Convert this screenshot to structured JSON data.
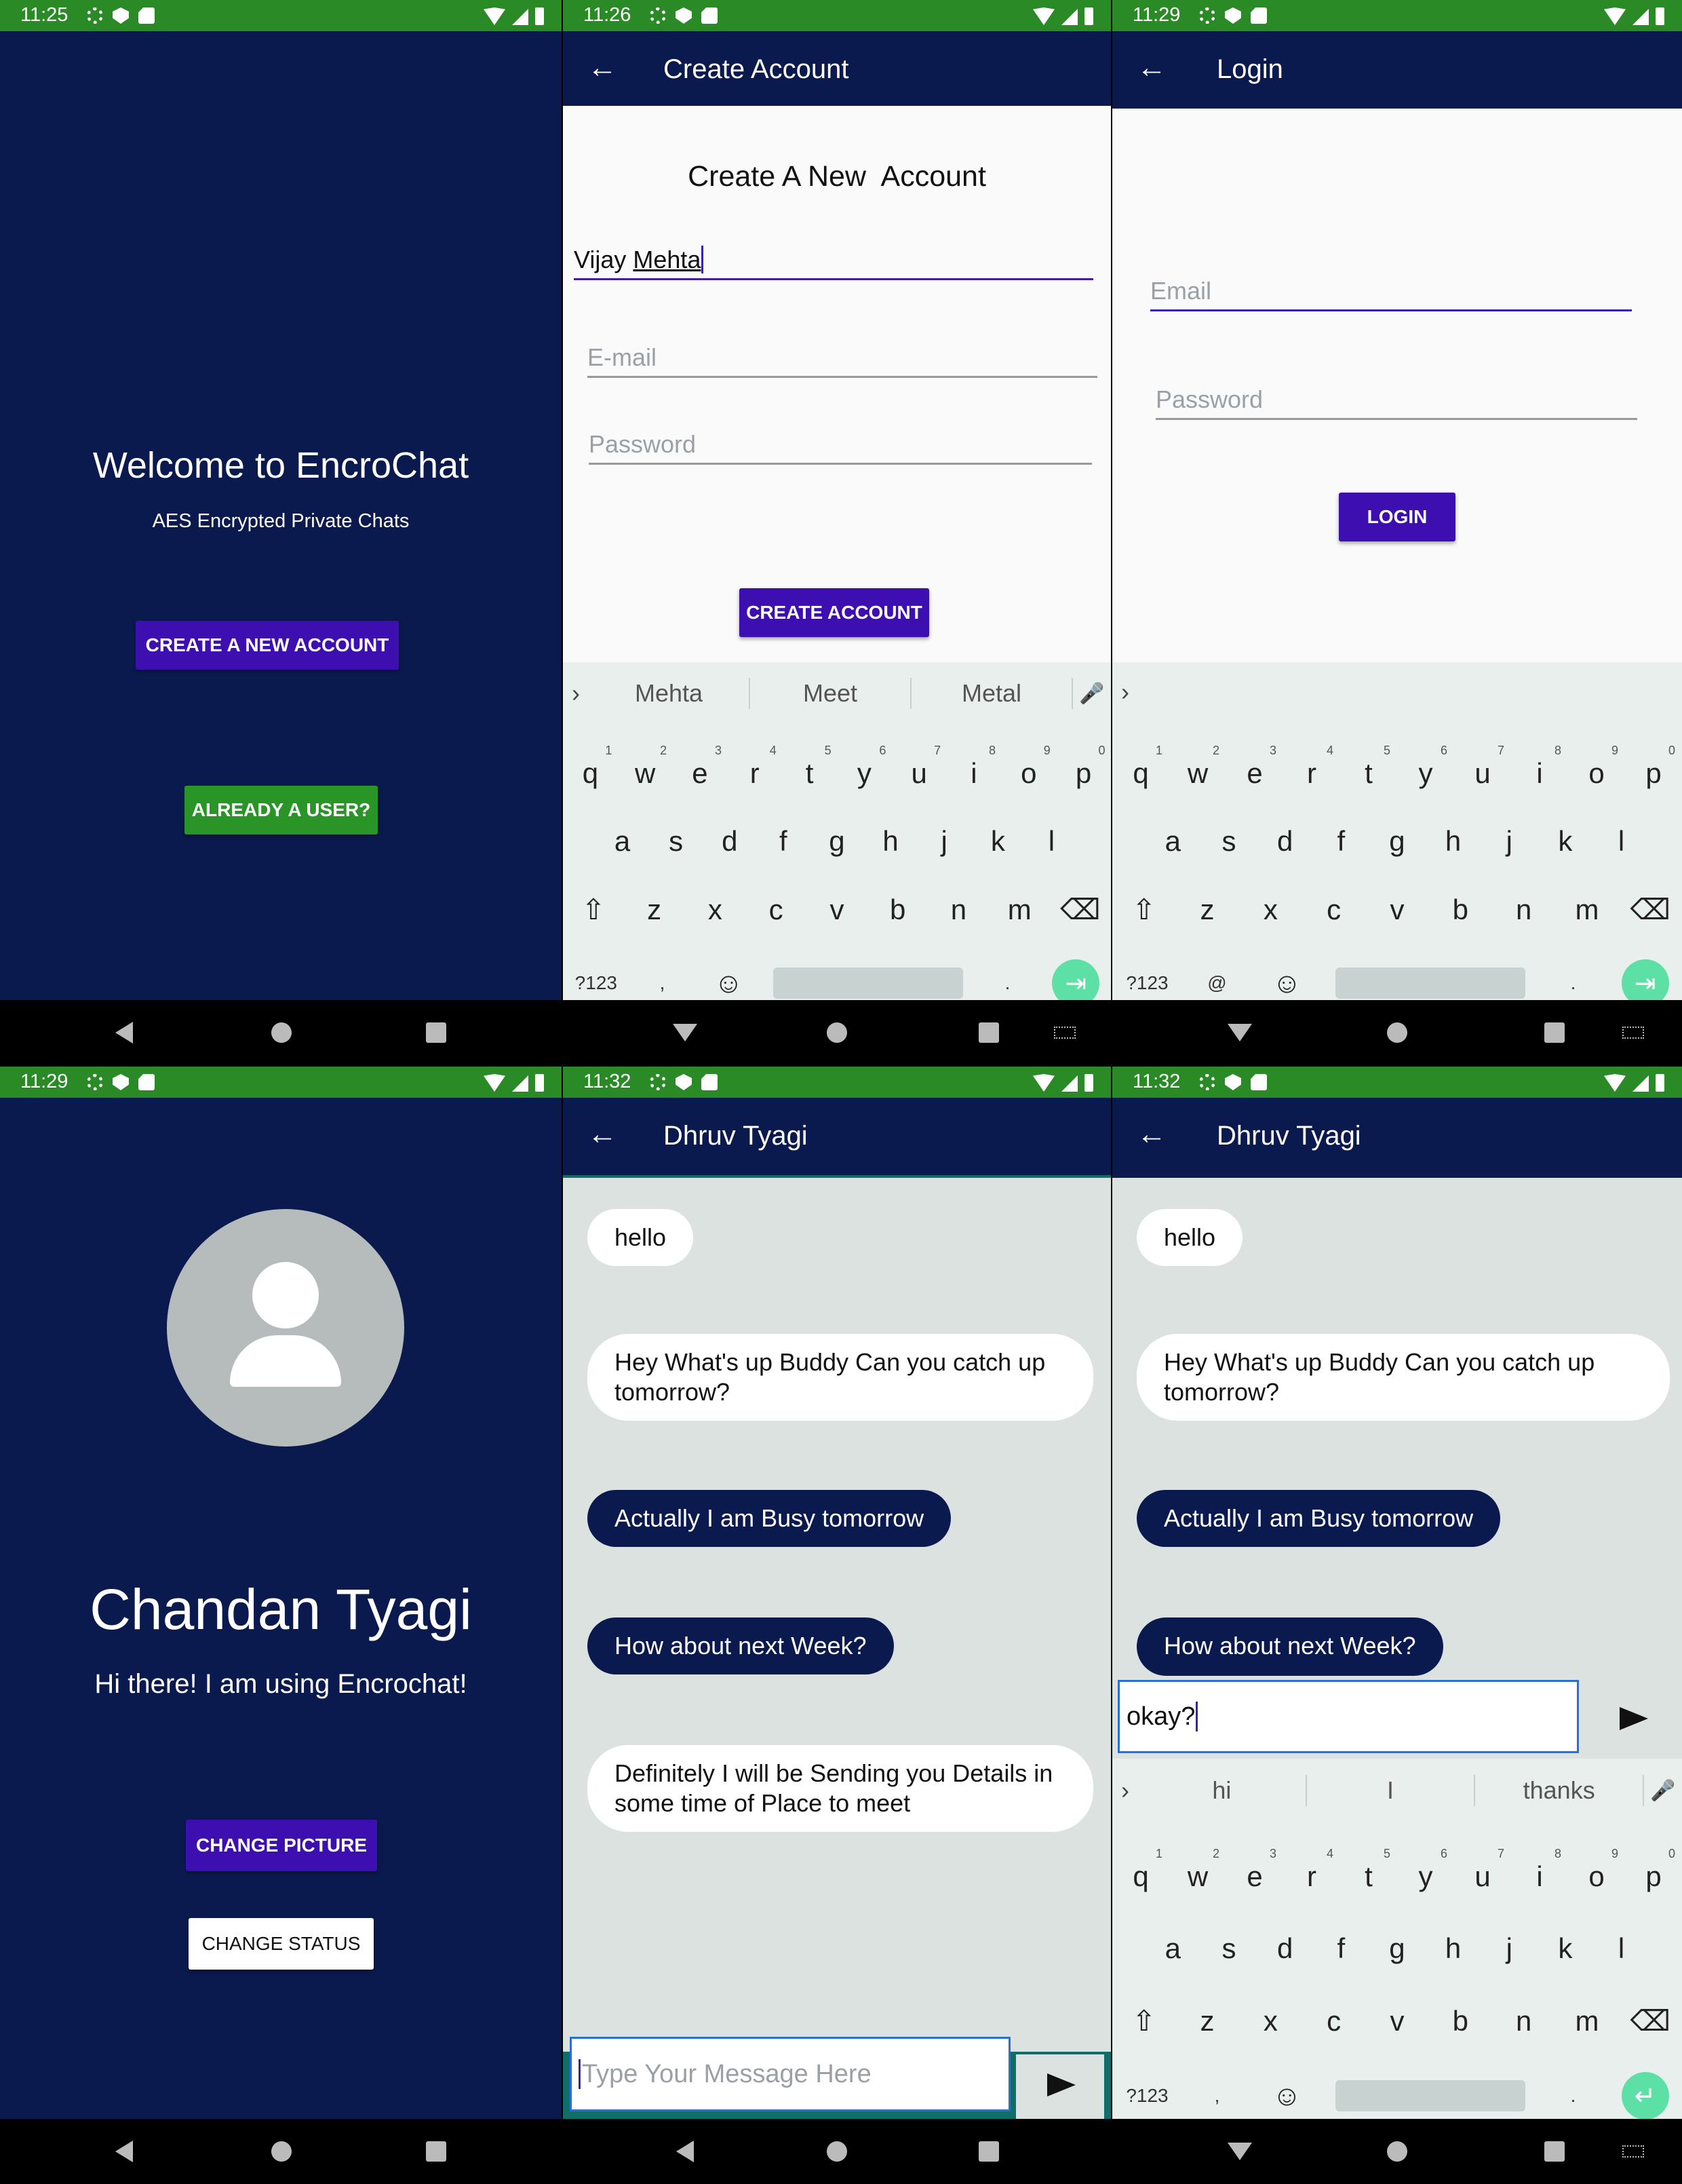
{
  "status_times": [
    "11:25",
    "11:26",
    "11:29",
    "11:29",
    "11:32",
    "11:32"
  ],
  "welcome": {
    "title": "Welcome to EncroChat",
    "subtitle": "AES Encrypted Private Chats",
    "create_btn": "CREATE A NEW ACCOUNT",
    "already_btn": "ALREADY A USER?"
  },
  "create": {
    "appbar": "Create Account",
    "heading": "Create A New  Account",
    "name_first": "Vijay ",
    "name_last": "Mehta",
    "email_ph": "E-mail",
    "password_ph": "Password",
    "button": "CREATE ACCOUNT",
    "suggestions": [
      "Mehta",
      "Meet",
      "Metal"
    ]
  },
  "login": {
    "appbar": "Login",
    "email_ph": "Email",
    "password_ph": "Password",
    "button": "LOGIN"
  },
  "profile": {
    "name": "Chandan Tyagi",
    "status": "Hi there! I am using Encrochat!",
    "change_picture": "CHANGE PICTURE",
    "change_status": "CHANGE STATUS"
  },
  "chat": {
    "contact": "Dhruv Tyagi",
    "messages": [
      {
        "text": "hello",
        "from": "them"
      },
      {
        "text": "Hey What's up Buddy Can you catch up tomorrow?",
        "from": "them"
      },
      {
        "text": "Actually I am Busy tomorrow",
        "from": "me"
      },
      {
        "text": "How about next Week?",
        "from": "me"
      },
      {
        "text": "Definitely I will be Sending you Details in some time of Place to meet",
        "from": "them"
      }
    ],
    "input_placeholder": "Type Your Message Here",
    "typed": "okay?",
    "suggestions": [
      "hi",
      "I",
      "thanks"
    ]
  },
  "keyboard": {
    "row1": [
      "q",
      "w",
      "e",
      "r",
      "t",
      "y",
      "u",
      "i",
      "o",
      "p"
    ],
    "row1_nums": [
      "1",
      "2",
      "3",
      "4",
      "5",
      "6",
      "7",
      "8",
      "9",
      "0"
    ],
    "row2": [
      "a",
      "s",
      "d",
      "f",
      "g",
      "h",
      "j",
      "k",
      "l"
    ],
    "row3": [
      "z",
      "x",
      "c",
      "v",
      "b",
      "n",
      "m"
    ],
    "symbols_key": "?123",
    "comma": ",",
    "at": "@",
    "period": "."
  },
  "colors": {
    "navy": "#0b1a4e",
    "status_green": "#2a8b26",
    "purple": "#3d0fb1",
    "button_green": "#2a9527",
    "chat_bg": "#dbe2e0",
    "keyboard_bg": "#e8efed",
    "enter_key": "#5de0a6"
  }
}
